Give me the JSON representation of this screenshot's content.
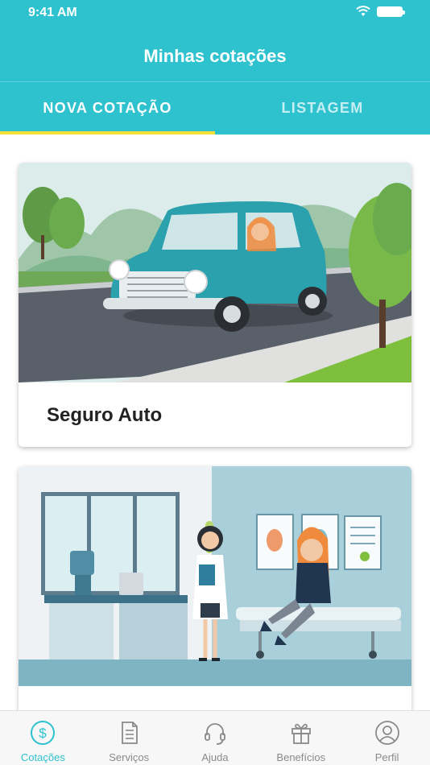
{
  "status_bar": {
    "time": "9:41 AM"
  },
  "header": {
    "title": "Minhas cotações"
  },
  "tabs": [
    {
      "label": "NOVA COTAÇÃO",
      "active": true
    },
    {
      "label": "LISTAGEM",
      "active": false
    }
  ],
  "cards": [
    {
      "label": "Seguro Auto",
      "illustration": "car-illustration"
    },
    {
      "label": "",
      "illustration": "clinic-illustration"
    }
  ],
  "bottom_nav": [
    {
      "label": "Cotações",
      "icon": "dollar-icon",
      "active": true
    },
    {
      "label": "Serviços",
      "icon": "document-icon",
      "active": false
    },
    {
      "label": "Ajuda",
      "icon": "headset-icon",
      "active": false
    },
    {
      "label": "Benefícios",
      "icon": "gift-icon",
      "active": false
    },
    {
      "label": "Perfil",
      "icon": "user-icon",
      "active": false
    }
  ],
  "colors": {
    "primary": "#2ec2cf",
    "tab_indicator": "#f4e03a",
    "inactive_nav": "#8a8a8a"
  }
}
